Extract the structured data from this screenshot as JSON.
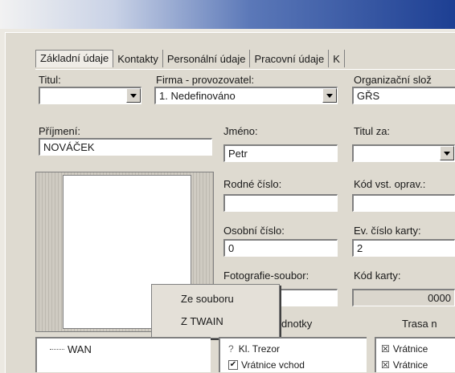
{
  "tabs": [
    "Základní údaje",
    "Kontakty",
    "Personální údaje",
    "Pracovní údaje",
    "K"
  ],
  "labels": {
    "titul": "Titul:",
    "firma": "Firma - provozovatel:",
    "org": "Organizační slož",
    "prijmeni": "Příjmení:",
    "jmeno": "Jméno:",
    "titul_za": "Titul za:",
    "rodne": "Rodné číslo:",
    "kod_vst": "Kód vst. oprav.:",
    "osobni": "Osobní číslo:",
    "ev_cislo": "Ev. číslo karty:",
    "foto": "Fotografie-soubor:",
    "kod_karty": "Kód karty:",
    "jednotky": "dnotky",
    "trasa": "Trasa n"
  },
  "values": {
    "titul": "",
    "firma": "1. Nedefinováno",
    "org": "GŘS",
    "prijmeni": "NOVÁČEK",
    "jmeno": "Petr",
    "titul_za": "",
    "rodne": "",
    "kod_vst": "",
    "osobni": "0",
    "ev_cislo": "2",
    "kod_karty": "0000"
  },
  "context_menu": [
    "Ze souboru",
    "Z TWAIN"
  ],
  "tree": {
    "item": "WAN"
  },
  "jednotky_list": [
    {
      "label": "Kl. Trezor",
      "mark": "?"
    },
    {
      "label": "Vrátnice vchod",
      "mark": "✔"
    }
  ],
  "trasa_list": [
    {
      "label": "Vrátnice",
      "mark": "☒"
    },
    {
      "label": "Vrátnice",
      "mark": "☒"
    }
  ]
}
